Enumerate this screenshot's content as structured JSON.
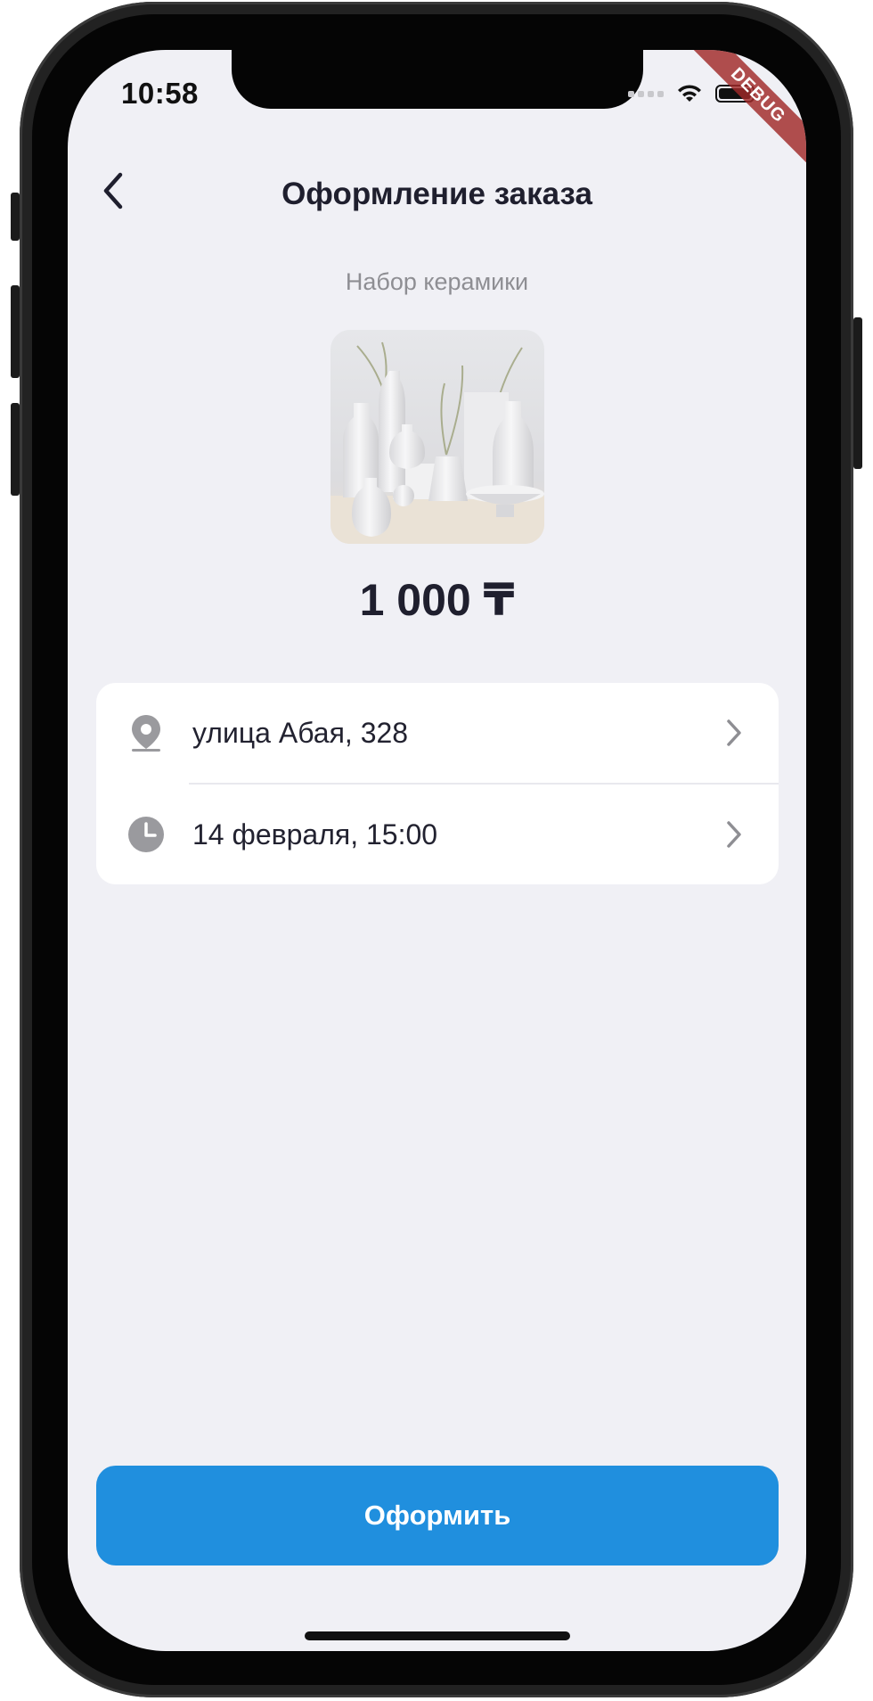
{
  "status_bar": {
    "time": "10:58",
    "debug_label": "DEBUG"
  },
  "nav": {
    "title": "Оформление заказа",
    "back_icon": "chevron-left-icon"
  },
  "product": {
    "name": "Набор керамики",
    "image": "ceramic-vases-photo",
    "price": "1 000 ₸"
  },
  "details": [
    {
      "icon": "location-pin-icon",
      "label": "улица Абая, 328"
    },
    {
      "icon": "clock-icon",
      "label": "14 февраля, 15:00"
    }
  ],
  "submit": {
    "label": "Оформить"
  },
  "colors": {
    "background": "#f0f0f5",
    "card": "#ffffff",
    "accent": "#208fde",
    "text_primary": "#1f1f2e",
    "text_secondary": "#8e8e93",
    "icon_gray": "#9a9a9e"
  }
}
